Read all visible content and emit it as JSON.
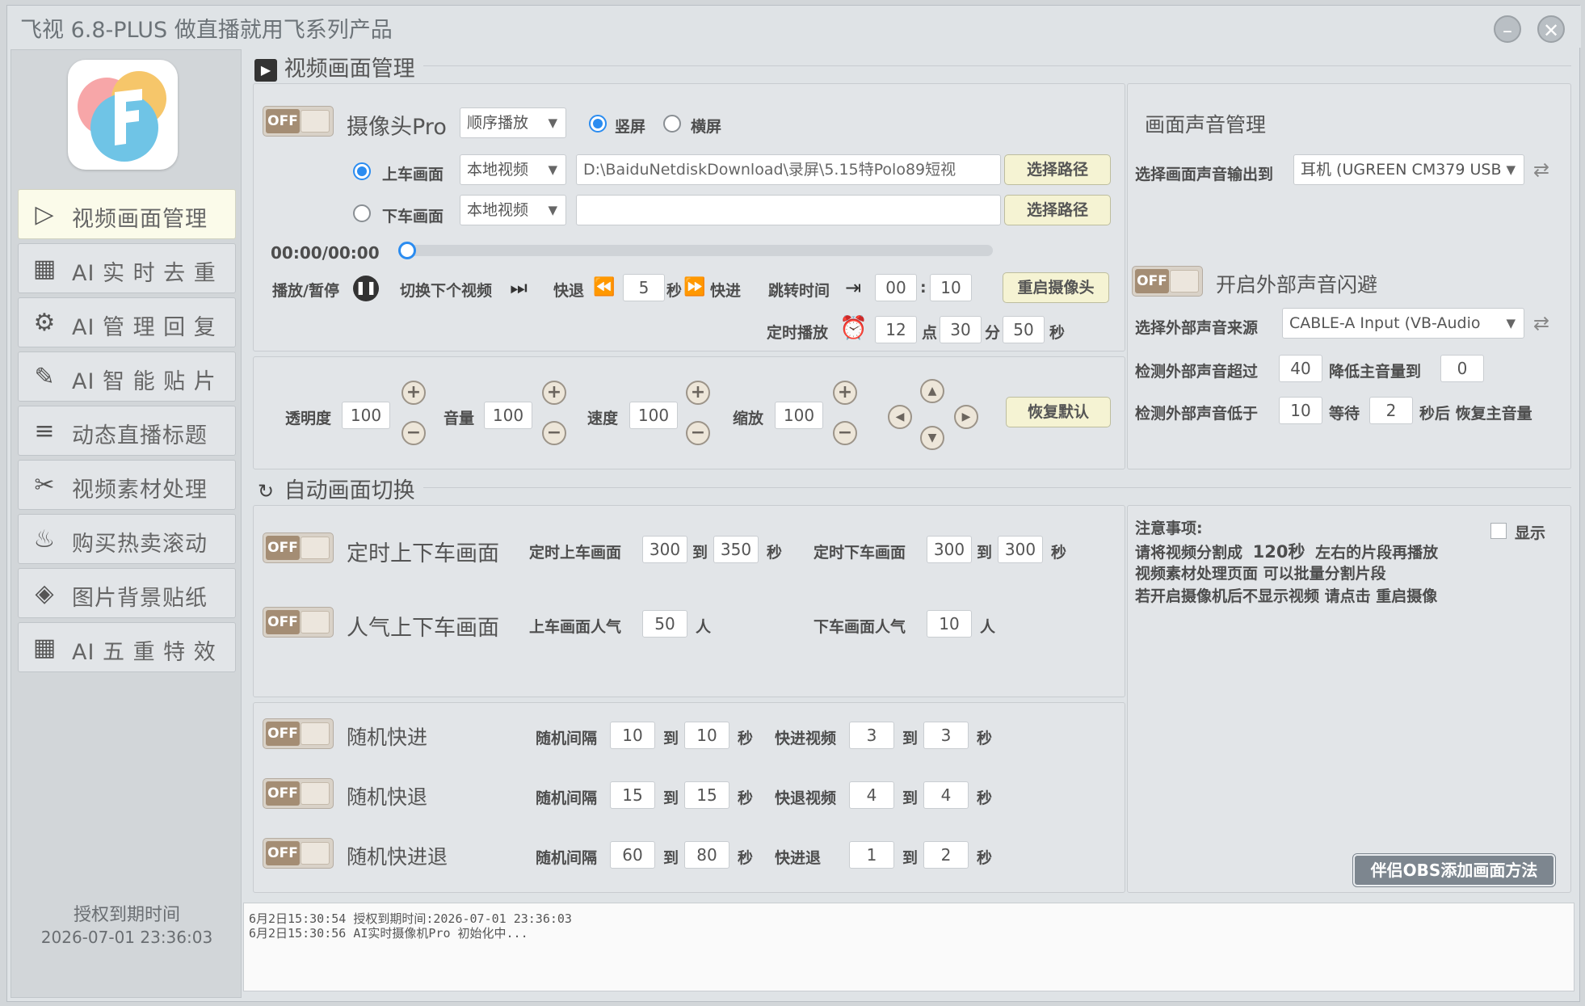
{
  "window": {
    "title": "飞视 6.8-PLUS 做直播就用飞系列产品",
    "minimize": "–",
    "close": "✕"
  },
  "sidebar": {
    "items": [
      {
        "label": "视频画面管理",
        "icon": "play-frame-icon",
        "glyph": "▷"
      },
      {
        "label": "AI 实 时 去 重",
        "icon": "chip-icon",
        "glyph": "▦"
      },
      {
        "label": "AI 管 理 回 复",
        "icon": "user-gear-icon",
        "glyph": "⚙"
      },
      {
        "label": "AI 智 能 贴 片",
        "icon": "sticker-icon",
        "glyph": "✎"
      },
      {
        "label": "动态直播标题",
        "icon": "title-icon",
        "glyph": "≡"
      },
      {
        "label": "视频素材处理",
        "icon": "scissors-icon",
        "glyph": "✂"
      },
      {
        "label": "购买热卖滚动",
        "icon": "hot-fire-icon",
        "glyph": "♨"
      },
      {
        "label": "图片背景贴纸",
        "icon": "tag-icon",
        "glyph": "◈"
      },
      {
        "label": "AI 五 重 特 效",
        "icon": "grid-icon",
        "glyph": "▦"
      }
    ],
    "expire_label": "授权到期时间",
    "expire_date": "2026-07-01 23:36:03"
  },
  "video": {
    "section_title": "视频画面管理",
    "toggle_off": "OFF",
    "camera_label": "摄像头Pro",
    "play_mode": "顺序播放",
    "portrait": "竖屏",
    "landscape": "横屏",
    "on_label": "上车画面",
    "off_label": "下车画面",
    "source1": "本地视频",
    "source2": "本地视频",
    "path1": "D:\\BaiduNetdiskDownload\\录屏\\5.15特Polo89短视",
    "path2": "",
    "choose_path": "选择路径",
    "time": "00:00/00:00",
    "progress": 0,
    "play_pause": "播放/暂停",
    "next_video": "切换下个视频",
    "rewind": "快退",
    "seek_seconds": "5",
    "sec": "秒",
    "forward": "快进",
    "jump_time": "跳转时间",
    "jump_min": "00",
    "jump_colon": ":",
    "jump_sec": "10",
    "restart_camera": "重启摄像头",
    "timed_play": "定时播放",
    "timed_hour": "12",
    "hour_unit": "点",
    "timed_min": "30",
    "min_unit": "分",
    "timed_sec": "50",
    "sec_unit": "秒",
    "opacity_label": "透明度",
    "opacity": "100",
    "volume_label": "音量",
    "volume": "100",
    "speed_label": "速度",
    "speed": "100",
    "zoom_label": "缩放",
    "zoom": "100",
    "reset_default": "恢复默认"
  },
  "audio": {
    "title": "画面声音管理",
    "output_label": "选择画面声音输出到",
    "output_device": "耳机 (UGREEN CM379 USB",
    "ducking_label": "开启外部声音闪避",
    "source_label": "选择外部声音来源",
    "source_device": "CABLE-A Input (VB-Audio",
    "detect_over_label": "检测外部声音超过",
    "detect_over": "40",
    "lower_to_label": "降低主音量到",
    "lower_to": "0",
    "detect_below_label": "检测外部声音低于",
    "detect_below": "10",
    "wait_label": "等待",
    "wait": "2",
    "restore_label": "秒后 恢复主音量"
  },
  "auto": {
    "section_title": "自动画面切换",
    "timed_switch": "定时上下车画面",
    "timed_on_label": "定时上车画面",
    "timed_on_from": "300",
    "to": "到",
    "timed_on_to": "350",
    "sec": "秒",
    "timed_off_label": "定时下车画面",
    "timed_off_from": "300",
    "timed_off_to": "300",
    "pop_switch": "人气上下车画面",
    "pop_on_label": "上车画面人气",
    "pop_on": "50",
    "person": "人",
    "pop_off_label": "下车画面人气",
    "pop_off": "10",
    "rand_ff": "随机快进",
    "rand_rw": "随机快退",
    "rand_ffrw": "随机快进退",
    "interval_label": "随机间隔",
    "ff_video_label": "快进视频",
    "rw_video_label": "快退视频",
    "ffrw_label": "快进退",
    "ff_int_from": "10",
    "ff_int_to": "10",
    "ff_from": "3",
    "ff_to": "3",
    "rw_int_from": "15",
    "rw_int_to": "15",
    "rw_from": "4",
    "rw_to": "4",
    "ffrw_int_from": "60",
    "ffrw_int_to": "80",
    "ffrw_from": "1",
    "ffrw_to": "2"
  },
  "notes": {
    "title": "注意事项:",
    "line1a": "请将视频分割成",
    "line1b": "120秒",
    "line1c": "左右的片段再播放",
    "line2": "视频素材处理页面  可以批量分割片段",
    "line3": "若开启摄像机后不显示视频 请点击 重启摄像",
    "show_label": "显示",
    "obs_button": "伴侣OBS添加画面方法"
  },
  "log": [
    "6月2日15:30:54 授权到期时间:2026-07-01 23:36:03",
    "6月2日15:30:56 AI实时摄像机Pro 初始化中..."
  ]
}
